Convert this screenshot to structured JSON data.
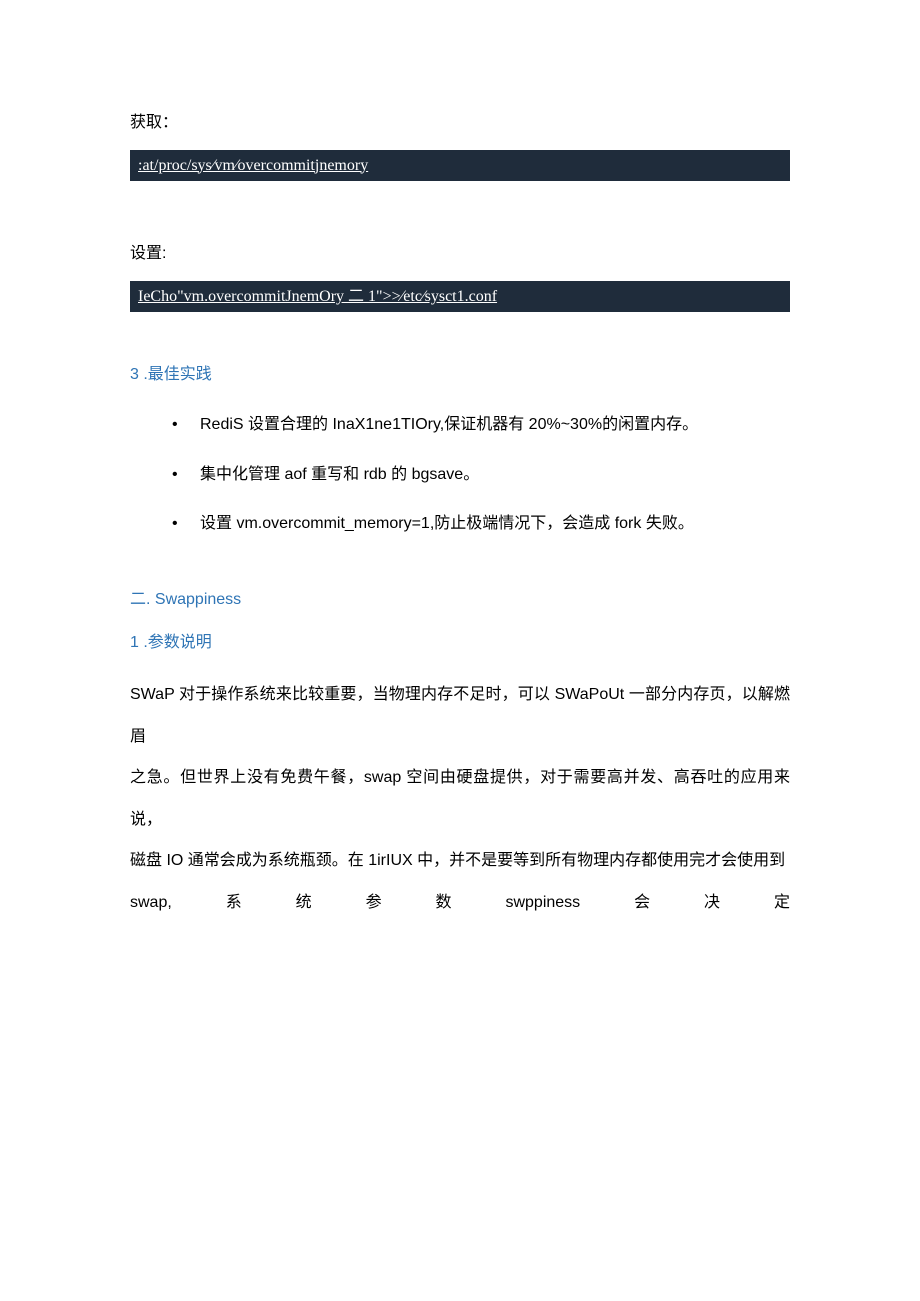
{
  "labels": {
    "get": "获取：",
    "set": "设置:"
  },
  "code": {
    "get_cmd": ":at/proc/sys⁄vm⁄overcommitjnemory",
    "set_cmd": "IeCho\"vm.overcommitJnemOry 二 1\">>⁄etc⁄sysct1.conf"
  },
  "section3": {
    "title": "3  .最佳实践",
    "bullets": [
      "RediS 设置合理的 InaX1ne1TIOry,保证机器有 20%~30%的闲置内存。",
      "集中化管理 aof 重写和 rdb 的 bgsave。",
      "设置 vm.overcommit_memory=1,防止极端情况下，会造成 fork 失败。"
    ]
  },
  "section_swap": {
    "heading1": "二. Swappiness",
    "heading2": "1  .参数说明",
    "para_line1": "SWaP 对于操作系统来比较重要，当物理内存不足时，可以 SWaPoUt 一部分内存页，以解燃眉",
    "para_line2": "之急。但世界上没有免费午餐，swap 空间由硬盘提供，对于需要高并发、高吞吐的应用来说，",
    "para_line3": "磁盘 IO 通常会成为系统瓶颈。在 1irIUX 中，并不是要等到所有物理内存都使用完才会使用到",
    "para_line4_tokens": [
      "swap,",
      "系",
      "统",
      "参",
      "数",
      "swppiness",
      "会",
      "决",
      "定"
    ]
  }
}
